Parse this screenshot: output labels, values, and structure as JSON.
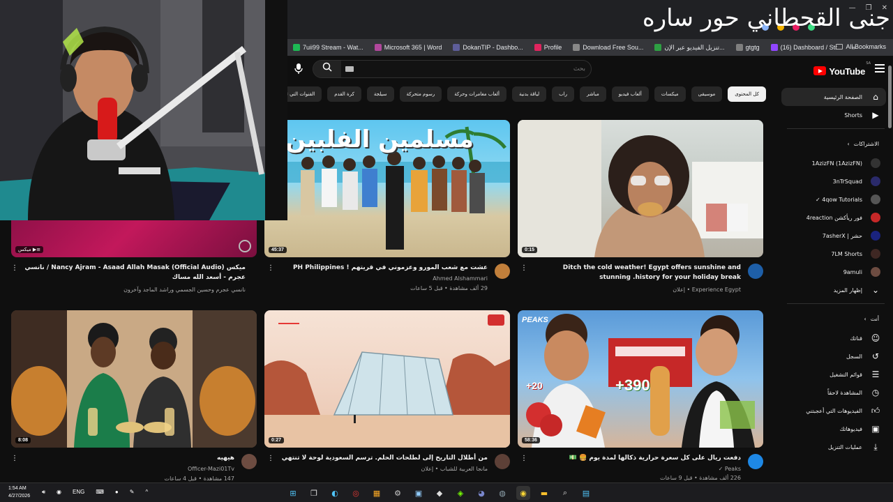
{
  "overlay": {
    "title": "جنى القحطاني  حور ساره"
  },
  "bookmarks": [
    {
      "label": "7uii99 Stream - Wat...",
      "color": "#1db954"
    },
    {
      "label": "Microsoft 365 | Word",
      "color": "#b1479c"
    },
    {
      "label": "DokanTIP - Dashbo...",
      "color": "#5e5e9a"
    },
    {
      "label": "Profile",
      "color": "#e0245e"
    },
    {
      "label": "Download Free Sou...",
      "color": "#888888"
    },
    {
      "label": "تنزيل الفيديو عبر الإن...",
      "color": "#2ea043"
    },
    {
      "label": "gtgtg",
      "color": "#7f7f7f"
    },
    {
      "label": "(16) Dashboard / Str...",
      "color": "#9146ff"
    }
  ],
  "bookmarks_more": "»",
  "bookmarks_all": "All Bookmarks",
  "header": {
    "search_placeholder": "بحث",
    "logo_text": "YouTube",
    "logo_region": "SA"
  },
  "chips": [
    {
      "label": "كل المحتوى",
      "active": true
    },
    {
      "label": "موسيقى"
    },
    {
      "label": "ميكسات"
    },
    {
      "label": "ألعاب فيديو"
    },
    {
      "label": "مباشر"
    },
    {
      "label": "راب"
    },
    {
      "label": "لياقة بدنية"
    },
    {
      "label": "ألعاب مغامرات وحركة"
    },
    {
      "label": "رسوم متحركة"
    },
    {
      "label": "سيلجة"
    },
    {
      "label": "كرة القدم"
    },
    {
      "label": "القنوات التي تم تحميلها مؤخراً"
    }
  ],
  "sidebar": {
    "main": [
      {
        "label": "الصفحة الرئيسية",
        "icon": "home-icon"
      },
      {
        "label": "Shorts",
        "icon": "shorts-icon"
      }
    ],
    "subs_heading": "الاشتراكات",
    "subs": [
      {
        "label": "1AzizFN (1AzizFN)",
        "color": "#333333"
      },
      {
        "label": "3nTrSquad",
        "color": "#2a2a6a"
      },
      {
        "label": "4qow Tutorials ✓",
        "color": "#555555"
      },
      {
        "label": "فور ريأكشن 4reaction",
        "color": "#c62828"
      },
      {
        "label": "حشر | 7asherX",
        "color": "#1a237e"
      },
      {
        "label": "7LM Shorts",
        "color": "#3e2723"
      },
      {
        "label": "9amuli",
        "color": "#6d4c41"
      }
    ],
    "show_more": "إظهار المزيد",
    "you_heading": "أنت",
    "you": [
      {
        "label": "قناتك",
        "icon": "channel-icon"
      },
      {
        "label": "السجل",
        "icon": "history-icon"
      },
      {
        "label": "قوائم التشغيل",
        "icon": "playlists-icon"
      },
      {
        "label": "المشاهدة لاحقاً",
        "icon": "watch-later-icon"
      },
      {
        "label": "الفيديوهات التي أعجبتني",
        "icon": "liked-icon"
      },
      {
        "label": "فيديوهاتك",
        "icon": "your-videos-icon"
      },
      {
        "label": "عمليات التنزيل",
        "icon": "downloads-icon"
      }
    ]
  },
  "videos_row1": [
    {
      "title": "Ditch the cold weather! Egypt offers sunshine and stunning .history for your holiday break",
      "meta1": "Experience Egypt • إعلان",
      "meta2": "",
      "duration": "0:15",
      "avatar": "#1e5fa8"
    },
    {
      "title": "عشت مع شعب المورو وعزموني في قريتهم ! PH Philippines",
      "meta1": "Ahmed Alshammari",
      "meta2": "29 ألف مشاهدة • قبل 5 ساعات",
      "duration": "45:37",
      "avatar": "#c17f3b",
      "thumb_text": "مسلمين الفلبين"
    },
    {
      "title": "ميكس (Nancy Ajram - Asaad Allah Masak (Official Audio / نانسي عجرم - أسعد الله مساك",
      "meta1": "نانسي عجرم وحسين الجسمي وراشد الماجد وآخرون",
      "meta2": "",
      "duration": "",
      "mix_label": "ميكس"
    }
  ],
  "videos_row2": [
    {
      "title": "دفعت ريال على كل سعرة حرارية ذكالها لمدة يوم 🍔 💵",
      "meta1": "Peaks ✓",
      "meta2": "226 ألف مشاهدة • قبل 9 ساعات",
      "duration": "58:36",
      "avatar": "#1e88e5",
      "brand": "PEAKS",
      "kcal1": "+20",
      "kcal2": "+390"
    },
    {
      "title": "من أطلال التاريخ إلى لطلحات الحلم. ترسم السعودية لوحة لا تنتهي إلا نفسها",
      "meta1": "مانجا العربية للشباب • إعلان",
      "meta2": "",
      "duration": "0:27",
      "avatar": "#5d4037"
    },
    {
      "title": "هيهيه",
      "meta1": "Officer-Mazi01Tv",
      "meta2": "147 مشاهدة • قبل 4 ساعات",
      "duration": "8:08",
      "avatar": "#6d4c41"
    }
  ],
  "taskbar": {
    "time": "1:54 AM",
    "date": "4/27/2026",
    "lang": "ENG"
  }
}
